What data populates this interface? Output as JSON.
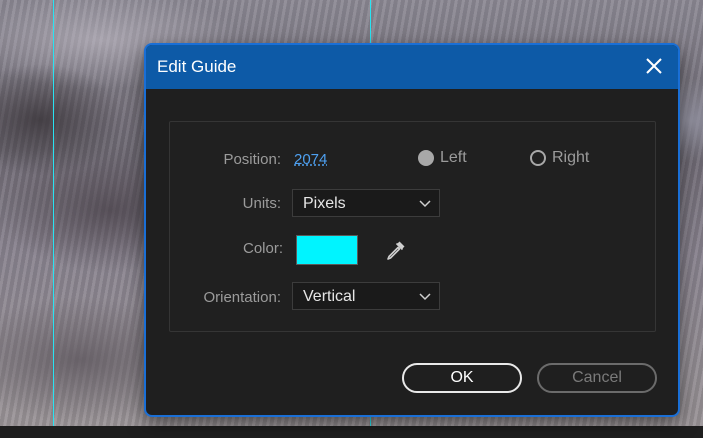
{
  "dialog": {
    "title": "Edit Guide",
    "close_icon": "close-icon"
  },
  "fields": {
    "position": {
      "label": "Position:",
      "value": "2074"
    },
    "units": {
      "label": "Units:",
      "value": "Pixels"
    },
    "color": {
      "label": "Color:",
      "value": "#00f4ff",
      "picker_icon": "eyedropper-icon"
    },
    "orientation": {
      "label": "Orientation:",
      "value": "Vertical"
    }
  },
  "alignment": {
    "left": {
      "label": "Left",
      "selected": true
    },
    "right": {
      "label": "Right",
      "selected": false
    }
  },
  "buttons": {
    "ok": "OK",
    "cancel": "Cancel"
  },
  "colors": {
    "titlebar": "#0d5aa7",
    "dialog_border": "#1a6fd6",
    "dialog_background": "#1f1f1f",
    "guide_line": "#28e3f2",
    "link": "#4ea0f0"
  }
}
